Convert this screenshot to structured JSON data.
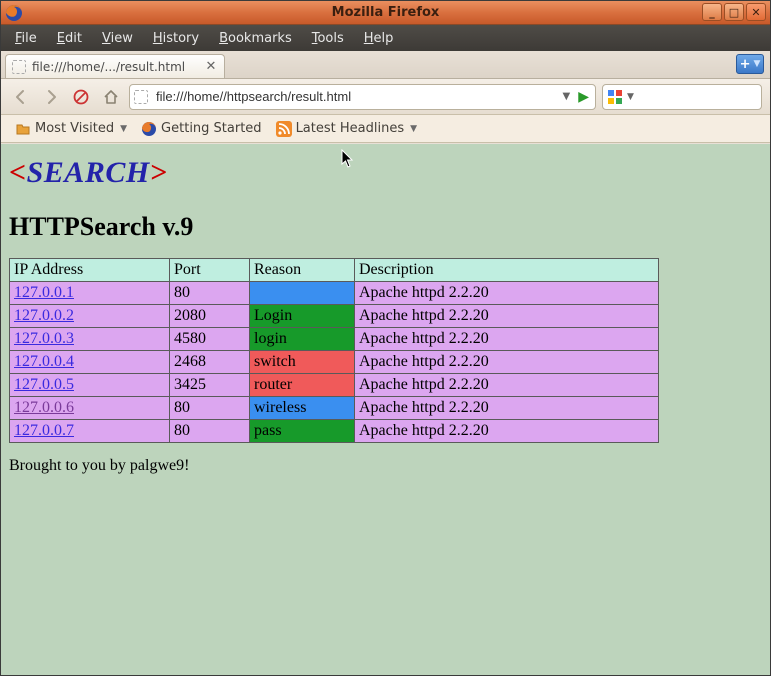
{
  "window": {
    "title": "Mozilla Firefox"
  },
  "menubar": {
    "items": [
      "File",
      "Edit",
      "View",
      "History",
      "Bookmarks",
      "Tools",
      "Help"
    ]
  },
  "tab": {
    "label": "file:///home/.../result.html"
  },
  "urlbar": {
    "value": "file:///home//httpsearch/result.html"
  },
  "bookmarks": {
    "most_visited": "Most Visited",
    "getting_started": "Getting Started",
    "latest_headlines": "Latest Headlines"
  },
  "page": {
    "logo_text": "SEARCH",
    "heading": "HTTPSearch v.9",
    "footer": "Brought to you by palgwe9!",
    "columns": [
      "IP Address",
      "Port",
      "Reason",
      "Description"
    ],
    "rows": [
      {
        "ip": "127.0.0.1",
        "port": "80",
        "reason": "",
        "reason_color": "blue",
        "desc": "Apache httpd 2.2.20",
        "visited": false
      },
      {
        "ip": "127.0.0.2",
        "port": "2080",
        "reason": "Login",
        "reason_color": "green",
        "desc": "Apache httpd 2.2.20",
        "visited": false
      },
      {
        "ip": "127.0.0.3",
        "port": "4580",
        "reason": "login",
        "reason_color": "green",
        "desc": "Apache httpd 2.2.20",
        "visited": false
      },
      {
        "ip": "127.0.0.4",
        "port": "2468",
        "reason": "switch",
        "reason_color": "red",
        "desc": "Apache httpd 2.2.20",
        "visited": false
      },
      {
        "ip": "127.0.0.5",
        "port": "3425",
        "reason": "router",
        "reason_color": "red",
        "desc": "Apache httpd 2.2.20",
        "visited": false
      },
      {
        "ip": "127.0.0.6",
        "port": "80",
        "reason": "wireless",
        "reason_color": "blue",
        "desc": "Apache httpd 2.2.20",
        "visited": true
      },
      {
        "ip": "127.0.0.7",
        "port": "80",
        "reason": "pass",
        "reason_color": "green",
        "desc": "Apache httpd 2.2.20",
        "visited": false
      }
    ]
  },
  "icons": {
    "minimize": "_",
    "maximize": "□",
    "close": "✕",
    "newtab": "+",
    "go": "▶",
    "dropdown": "▼"
  }
}
